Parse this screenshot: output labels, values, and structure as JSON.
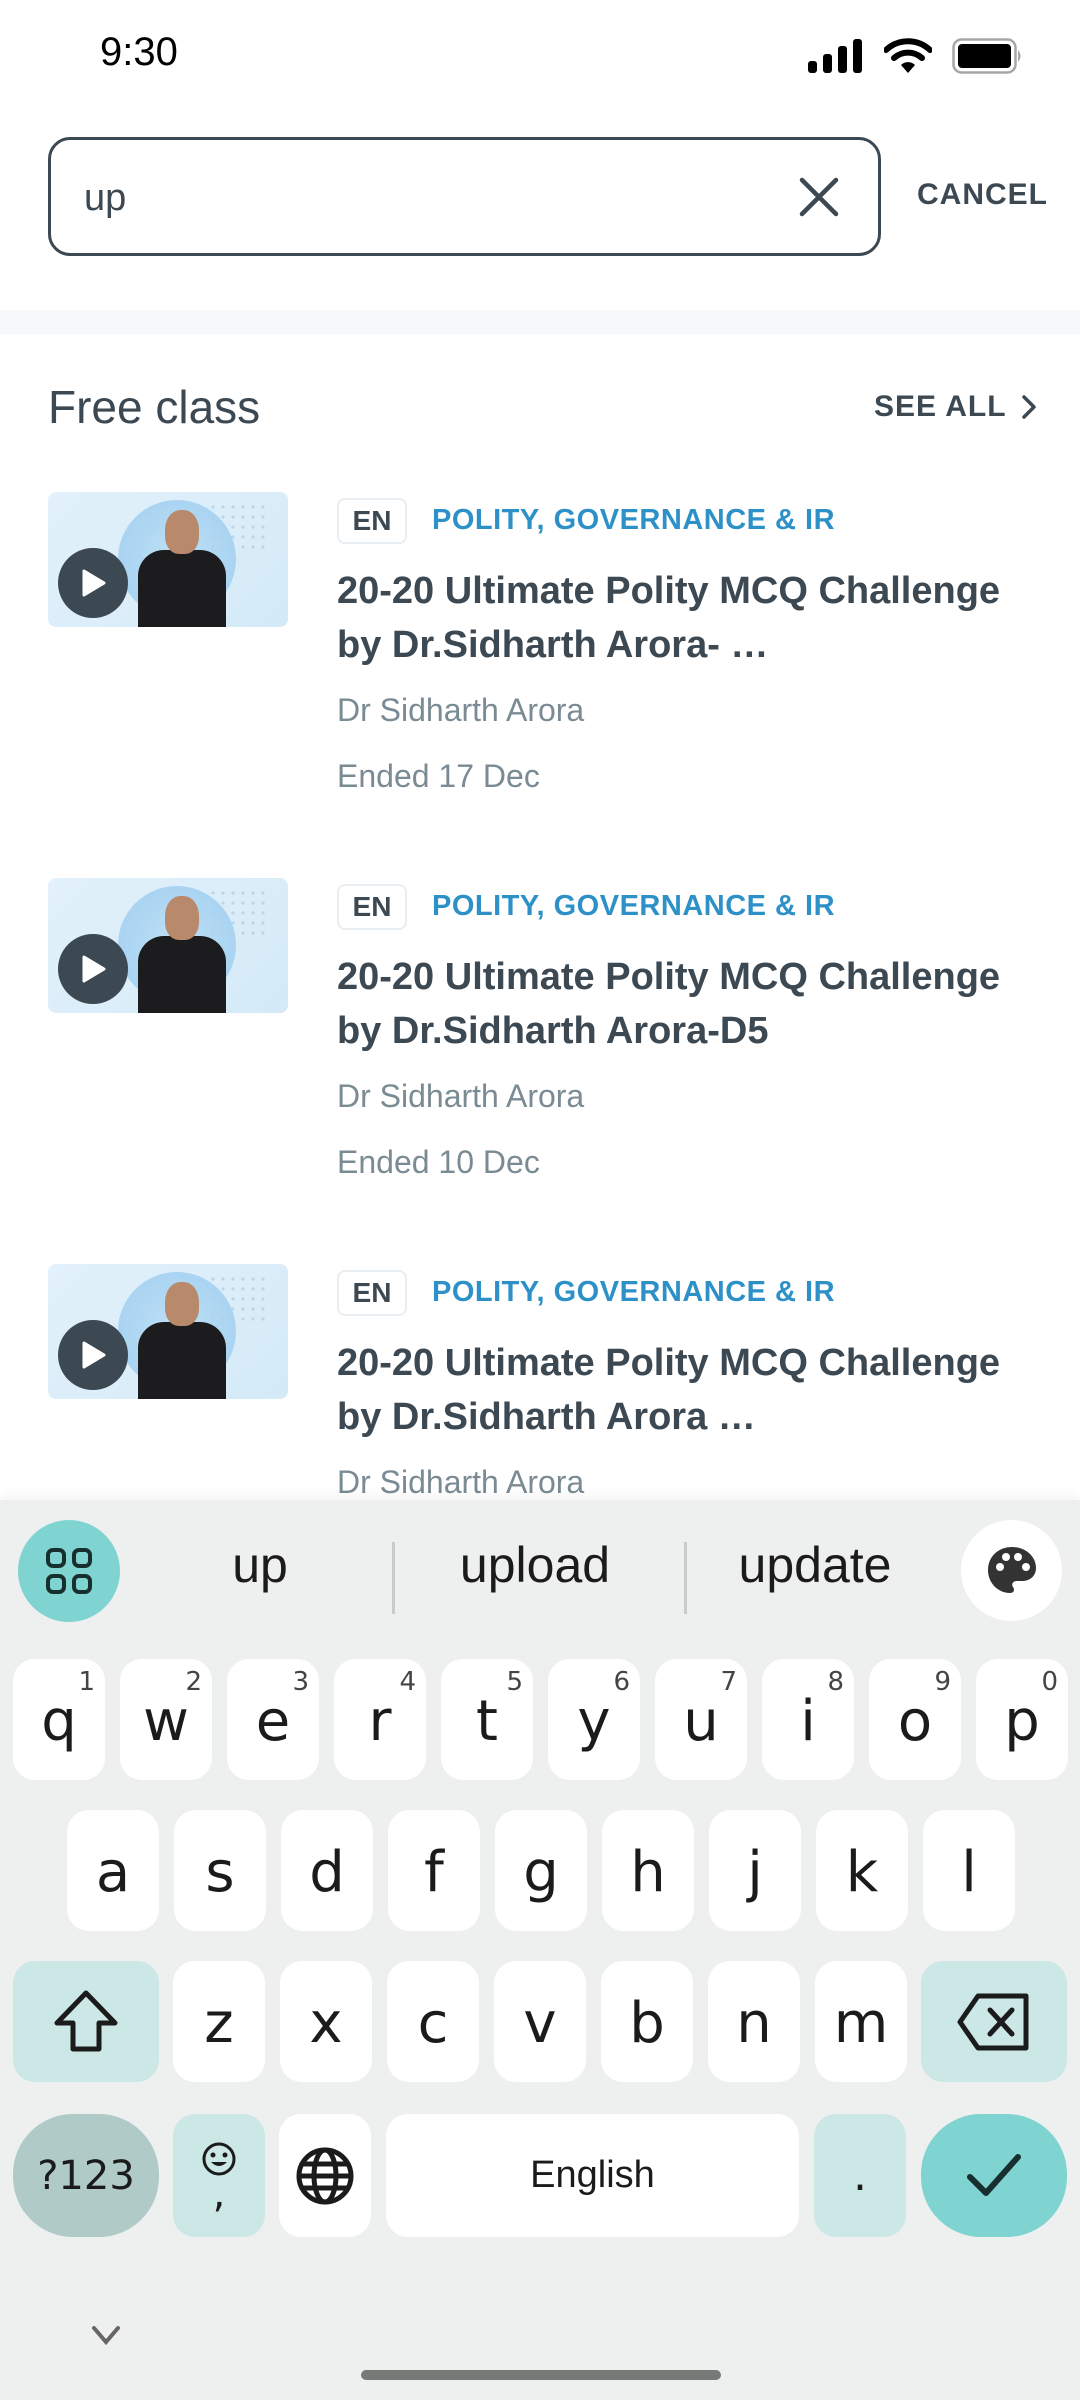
{
  "status_bar": {
    "time": "9:30",
    "icons": [
      "signal-icon",
      "wifi-icon",
      "battery-icon"
    ]
  },
  "search": {
    "value": "up",
    "placeholder": "",
    "clear_icon": "close-icon",
    "cancel_label": "CANCEL"
  },
  "section": {
    "title": "Free class",
    "see_all_label": "SEE ALL"
  },
  "colors": {
    "category": "#2d91c8",
    "text_primary": "#3c4852",
    "text_secondary": "#7a8b94",
    "keyboard_accent": "#7fd3d1"
  },
  "classes": [
    {
      "language": "EN",
      "category": "POLITY, GOVERNANCE & IR",
      "title": "20-20 Ultimate Polity MCQ Challenge by Dr.Sidharth Arora- …",
      "author": "Dr Sidharth Arora",
      "date": "Ended 17 Dec"
    },
    {
      "language": "EN",
      "category": "POLITY, GOVERNANCE & IR",
      "title": "20-20 Ultimate Polity MCQ Challenge by Dr.Sidharth Arora-D5",
      "author": "Dr Sidharth Arora",
      "date": "Ended 10 Dec"
    },
    {
      "language": "EN",
      "category": "POLITY, GOVERNANCE & IR",
      "title": "20-20 Ultimate Polity MCQ Challenge by Dr.Sidharth Arora …",
      "author": "Dr Sidharth Arora",
      "date": ""
    }
  ],
  "keyboard": {
    "suggestions": [
      "up",
      "upload",
      "update"
    ],
    "row1": [
      {
        "k": "q",
        "h": "1"
      },
      {
        "k": "w",
        "h": "2"
      },
      {
        "k": "e",
        "h": "3"
      },
      {
        "k": "r",
        "h": "4"
      },
      {
        "k": "t",
        "h": "5"
      },
      {
        "k": "y",
        "h": "6"
      },
      {
        "k": "u",
        "h": "7"
      },
      {
        "k": "i",
        "h": "8"
      },
      {
        "k": "o",
        "h": "9"
      },
      {
        "k": "p",
        "h": "0"
      }
    ],
    "row2": [
      "a",
      "s",
      "d",
      "f",
      "g",
      "h",
      "j",
      "k",
      "l"
    ],
    "row3": [
      "z",
      "x",
      "c",
      "v",
      "b",
      "n",
      "m"
    ],
    "symbols_label": "?123",
    "comma_label": ",",
    "space_label": "English",
    "period_label": "."
  }
}
